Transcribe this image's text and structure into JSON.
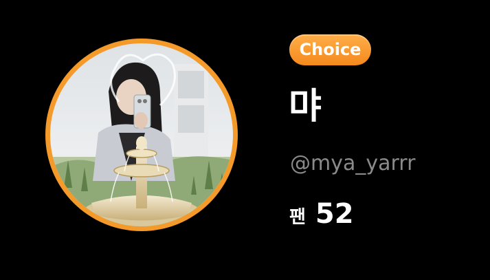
{
  "profile": {
    "badge_label": "Choice",
    "display_name": "먀",
    "username": "@mya_yarrr",
    "fans_label": "팬",
    "fans_count": "52"
  },
  "colors": {
    "background": "#000000",
    "accent_orange": "#f39a2b",
    "username_gray": "#8a8a8a",
    "text_white": "#ffffff"
  }
}
